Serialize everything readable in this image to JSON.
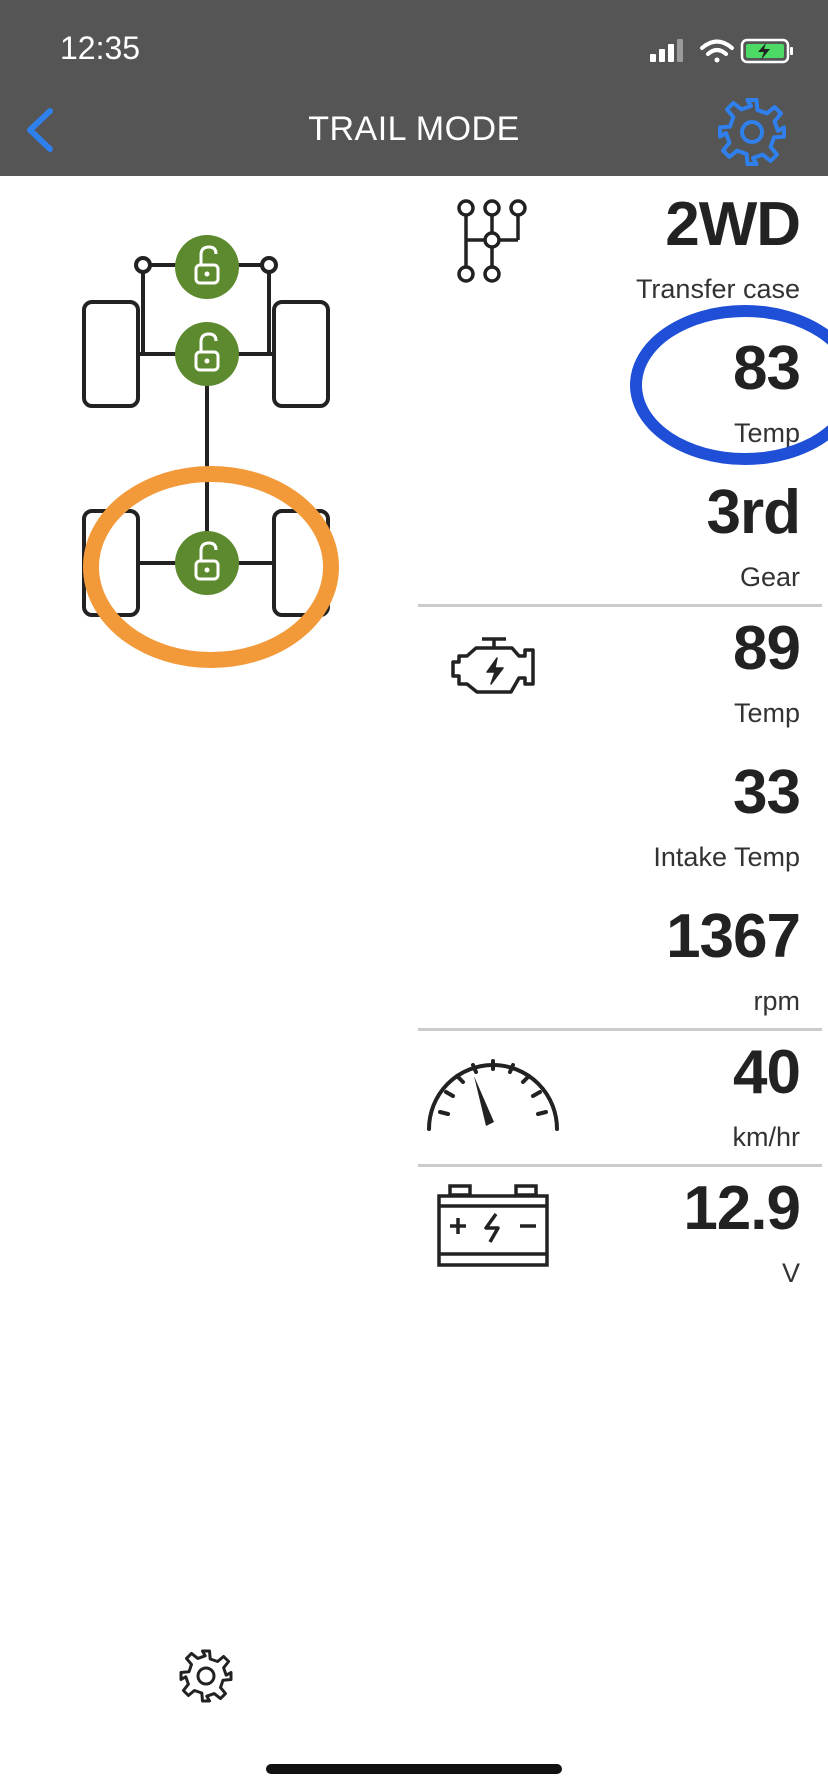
{
  "status_bar": {
    "time": "12:35"
  },
  "nav": {
    "title": "TRAIL MODE",
    "back_icon": "chevron-left-icon",
    "settings_icon": "gear-icon"
  },
  "colors": {
    "lock_green": "#5d8a2e",
    "accent_blue": "#2f80ed",
    "highlight_orange": "#f2993a",
    "highlight_blue": "#1f4fd6",
    "nav_bg": "#555555"
  },
  "drivetrain": {
    "locks": [
      {
        "position": "front-top",
        "state": "unlocked"
      },
      {
        "position": "front",
        "state": "unlocked"
      },
      {
        "position": "rear",
        "state": "unlocked"
      }
    ]
  },
  "transmission": {
    "transfer_case": {
      "value": "2WD",
      "label": "Transfer case"
    },
    "temp": {
      "value": "83",
      "label": "Temp"
    },
    "gear": {
      "value": "3rd",
      "label": "Gear"
    }
  },
  "engine": {
    "temp": {
      "value": "89",
      "label": "Temp"
    },
    "intake_temp": {
      "value": "33",
      "label": "Intake Temp"
    },
    "rpm": {
      "value": "1367",
      "label": "rpm"
    }
  },
  "speed": {
    "value": "40",
    "label": "km/hr"
  },
  "battery": {
    "value": "12.9",
    "label": "V"
  }
}
